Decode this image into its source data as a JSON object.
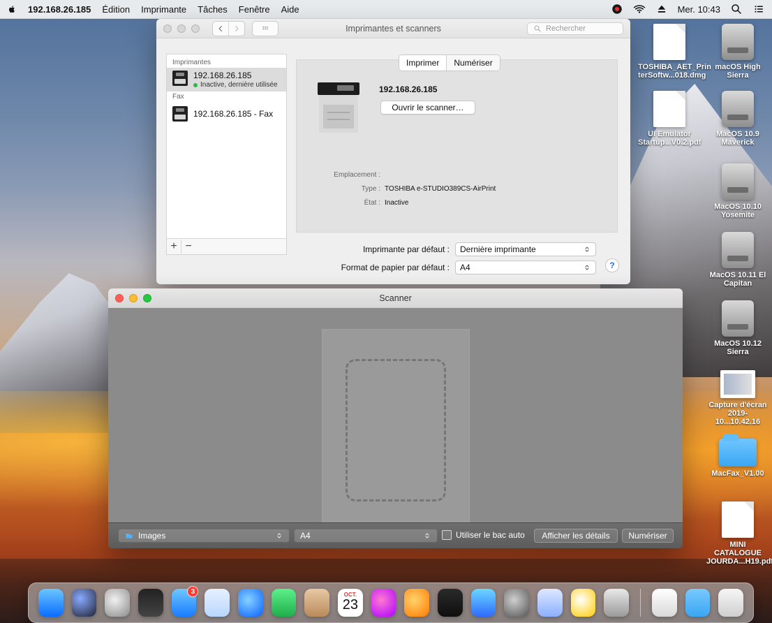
{
  "menubar": {
    "app": "192.168.26.185",
    "items": [
      "Édition",
      "Imprimante",
      "Tâches",
      "Fenêtre",
      "Aide"
    ],
    "clock": "Mer. 10:43"
  },
  "printers_window": {
    "title": "Imprimantes et scanners",
    "search_placeholder": "Rechercher",
    "list": {
      "printers_header": "Imprimantes",
      "printers": [
        {
          "name": "192.168.26.185",
          "status": "Inactive, dernière utilisée"
        }
      ],
      "fax_header": "Fax",
      "fax": [
        {
          "name": "192.168.26.185 - Fax"
        }
      ]
    },
    "tabs": [
      "Imprimer",
      "Numériser"
    ],
    "selected_tab": "Imprimer",
    "detail": {
      "name": "192.168.26.185",
      "open_scanner_label": "Ouvrir le scanner…",
      "fields": [
        {
          "label": "Emplacement :",
          "value": ""
        },
        {
          "label": "Type :",
          "value": "TOSHIBA e-STUDIO389CS-AirPrint"
        },
        {
          "label": "État :",
          "value": "Inactive"
        }
      ]
    },
    "defaults": {
      "default_printer_label": "Imprimante par défaut :",
      "default_printer_value": "Dernière imprimante",
      "default_paper_label": "Format de papier par défaut :",
      "default_paper_value": "A4"
    },
    "help_symbol": "?"
  },
  "scanner_window": {
    "title": "Scanner",
    "destination": "Images",
    "paper_size": "A4",
    "use_tray_label": "Utiliser le bac auto",
    "show_details_label": "Afficher les détails",
    "scan_label": "Numériser"
  },
  "desktop_icons": [
    {
      "label": "TOSHIBA_AET_Prin terSoftw...018.dmg",
      "kind": "doc"
    },
    {
      "label": "macOS High Sierra",
      "kind": "drive"
    },
    {
      "label": "UI Emulator Startup...V0.2.pdf",
      "kind": "doc"
    },
    {
      "label": "MacOS 10.9 Maverick",
      "kind": "drive"
    },
    {
      "label": "MacOS 10.10 Yosemite",
      "kind": "drive"
    },
    {
      "label": "MacOS 10.11 El Capitan",
      "kind": "drive"
    },
    {
      "label": "MacOS 10.12 Sierra",
      "kind": "drive"
    },
    {
      "label": "Capture d'écran 2019-10...10.42.16",
      "kind": "screenshot"
    },
    {
      "label": "MacFax_V1.00",
      "kind": "folder"
    },
    {
      "label": "MINI CATALOGUE JOURDA...H19.pdf",
      "kind": "doc"
    }
  ],
  "dock": {
    "calendar_month": "OCT.",
    "calendar_day": "23",
    "appstore_badge": "3"
  }
}
